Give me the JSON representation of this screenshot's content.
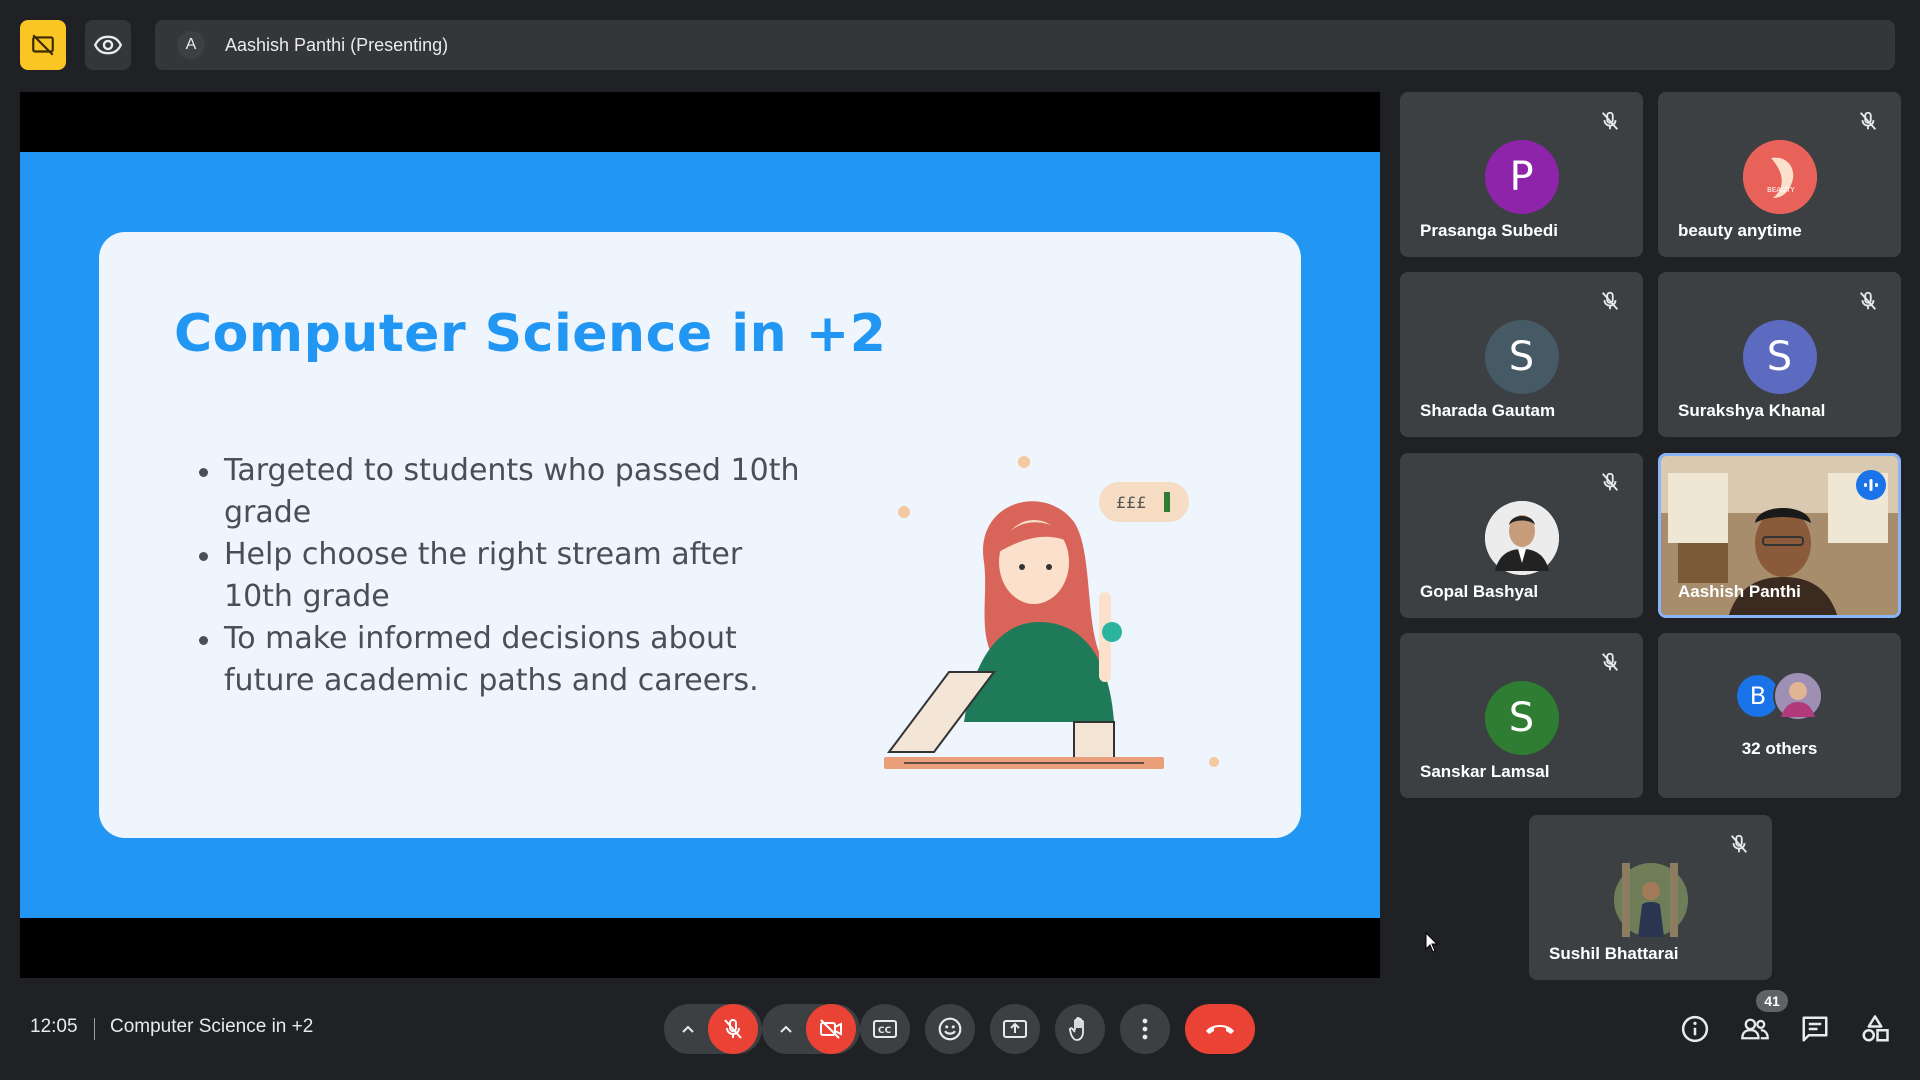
{
  "top_bar": {
    "presenter_initial": "A",
    "presenter_label": "Aashish Panthi (Presenting)"
  },
  "slide": {
    "title": "Computer Science in +2",
    "bullets": [
      "Targeted to students who passed 10th grade",
      "Help choose the right stream after 10th grade",
      "To make informed decisions about future academic paths and careers."
    ],
    "illustration_note": "£££"
  },
  "participants": [
    {
      "name": "Prasanga Subedi",
      "initial": "P",
      "color": "#8e24aa",
      "muted": true
    },
    {
      "name": "beauty anytime",
      "initial": "",
      "color": "#e8625a",
      "muted": true
    },
    {
      "name": "Sharada Gautam",
      "initial": "S",
      "color": "#455a64",
      "muted": true
    },
    {
      "name": "Surakshya Khanal",
      "initial": "S",
      "color": "#5c6bc0",
      "muted": true
    },
    {
      "name": "Gopal Bashyal",
      "initial": "",
      "color": "#e0e0e0",
      "muted": true
    },
    {
      "name": "Aashish Panthi",
      "initial": "",
      "color": "#6b5a46",
      "muted": false
    },
    {
      "name": "Sanskar Lamsal",
      "initial": "S",
      "color": "#2e7d32",
      "muted": true
    },
    {
      "name": "Sushil Bhattarai",
      "initial": "",
      "color": "#5d6b4a",
      "muted": true
    }
  ],
  "beauty_logo_text": "BEAUTY",
  "others": {
    "initial": "B",
    "label": "32 others"
  },
  "bottom_bar": {
    "time": "12:05",
    "meeting_title": "Computer Science in +2",
    "people_count": "41"
  },
  "colors": {
    "accent": "#2196f3",
    "danger": "#ea4335",
    "presenting_highlight": "#f9c623",
    "speaking_border": "#8ab4f8"
  }
}
